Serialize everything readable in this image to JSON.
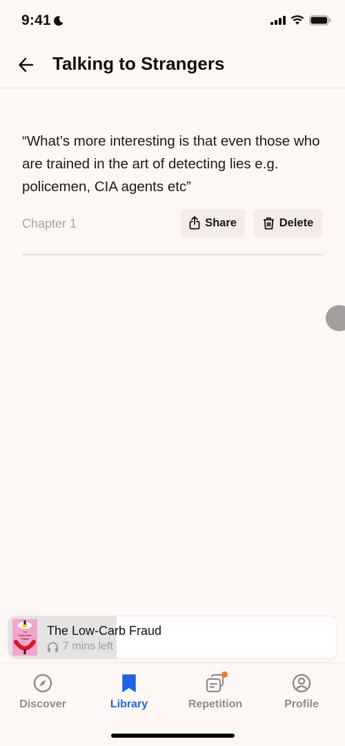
{
  "status_bar": {
    "time": "9:41",
    "icons": [
      "moon-icon",
      "cellular-signal-icon",
      "wifi-icon",
      "battery-icon"
    ]
  },
  "header": {
    "back_icon": "arrow-left-icon",
    "title": "Talking to Strangers"
  },
  "highlight": {
    "quote": "“What’s more interesting is that even those who are trained in the art of detecting lies e.g. policemen, CIA agents etc”",
    "chapter": "Chapter 1",
    "share_label": "Share",
    "share_icon": "share-icon",
    "delete_label": "Delete",
    "delete_icon": "trash-icon"
  },
  "mini_player": {
    "book_title": "The Low-Carb Fraud",
    "time_left": "7 mins left",
    "cover_text": "The Low-Carb Fraud",
    "headphones_icon": "headphones-icon",
    "progress_percent": 33
  },
  "tabbar": {
    "tabs": [
      {
        "label": "Discover",
        "icon": "compass-icon",
        "active": false
      },
      {
        "label": "Library",
        "icon": "bookmark-icon",
        "active": true
      },
      {
        "label": "Repetition",
        "icon": "cards-icon",
        "active": false,
        "badge": true
      },
      {
        "label": "Profile",
        "icon": "user-circle-icon",
        "active": false
      }
    ]
  },
  "colors": {
    "background": "#fdf8f6",
    "accent": "#1e63e6",
    "badge": "#f07a2f",
    "inactive": "#8f8b89"
  }
}
